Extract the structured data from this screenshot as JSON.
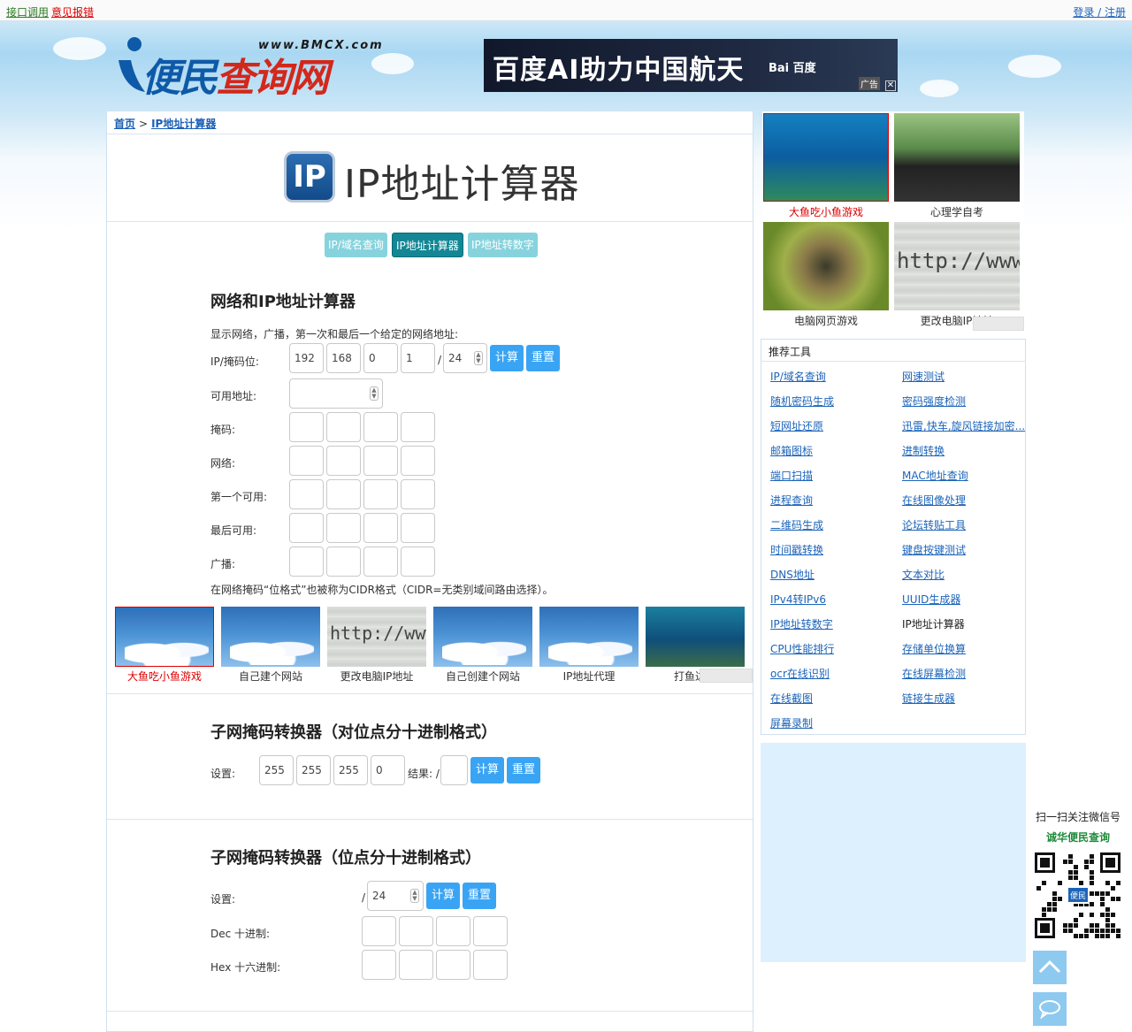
{
  "topbar": {
    "api_link": "接口调用",
    "report_link": "意见报错",
    "login": "登录 / 注册"
  },
  "header": {
    "logo_text_1": "便民",
    "logo_text_2": "查询网",
    "logo_url": "www.BMCX.com",
    "ad": {
      "text": "百度AI助力中国航天",
      "brand": "Bai 百度",
      "ad_tag": "广告",
      "close": "✕"
    }
  },
  "breadcrumb": {
    "home": "首页",
    "sep": ">",
    "current": "IP地址计算器"
  },
  "page": {
    "logo": "IP",
    "title": "IP地址计算器"
  },
  "tabs": [
    {
      "label": "IP/域名查询",
      "active": false
    },
    {
      "label": "IP地址计算器",
      "active": true
    },
    {
      "label": "IP地址转数字",
      "active": false
    }
  ],
  "calc1": {
    "heading": "网络和IP地址计算器",
    "desc": "显示网络，广播，第一次和最后一个给定的网络地址:",
    "ip_label": "IP/掩码位:",
    "ip": [
      "192",
      "168",
      "0",
      "1"
    ],
    "slash": "/",
    "mask": "24",
    "calc_btn": "计算",
    "reset_btn": "重置",
    "usable_label": "可用地址:",
    "mask_label": "掩码:",
    "network_label": "网络:",
    "first_label": "第一个可用:",
    "last_label": "最后可用:",
    "broadcast_label": "广播:",
    "note": "在网络掩码“位格式”也被称为CIDR格式（CIDR=无类别域间路由选择）。"
  },
  "thumbs": [
    {
      "caption": "大鱼吃小鱼游戏",
      "highlight": true
    },
    {
      "caption": "自己建个网站"
    },
    {
      "caption": "更改电脑IP地址"
    },
    {
      "caption": "自己创建个网站"
    },
    {
      "caption": "IP地址代理"
    },
    {
      "caption": "打鱼达人"
    }
  ],
  "calc2": {
    "heading": "子网掩码转换器（对位点分十进制格式）",
    "set_label": "设置:",
    "vals": [
      "255",
      "255",
      "255",
      "0"
    ],
    "result_label": "结果: /",
    "calc_btn": "计算",
    "reset_btn": "重置"
  },
  "calc3": {
    "heading": "子网掩码转换器（位点分十进制格式）",
    "set_label": "设置:",
    "slash": "/",
    "mask": "24",
    "calc_btn": "计算",
    "reset_btn": "重置",
    "dec_label": "Dec 十进制:",
    "hex_label": "Hex 十六进制:"
  },
  "side_grid": [
    {
      "caption": "大鱼吃小鱼游戏",
      "highlight": true
    },
    {
      "caption": "心理学自考"
    },
    {
      "caption": "电脑网页游戏"
    },
    {
      "caption": "更改电脑IP地址"
    }
  ],
  "tools": {
    "heading": "推荐工具",
    "items": [
      "IP/域名查询",
      "网速测试",
      "随机密码生成",
      "密码强度检测",
      "短网址还原",
      "迅雷,快车,旋风链接加密...",
      "邮箱图标",
      "进制转换",
      "端口扫描",
      "MAC地址查询",
      "进程查询",
      "在线图像处理",
      "二维码生成",
      "论坛转贴工具",
      "时间戳转换",
      "键盘按键测试",
      "DNS地址",
      "文本对比",
      "IPv4转IPv6",
      "UUID生成器",
      "IP地址转数字",
      "IP地址计算器",
      "CPU性能排行",
      "存储单位换算",
      "ocr在线识别",
      "在线屏幕检测",
      "在线截图",
      "链接生成器",
      "屏幕录制"
    ],
    "current": "IP地址计算器"
  },
  "float": {
    "scan_text": "扫一扫关注微信号",
    "account": "诚华便民查询",
    "qr_label": "便民"
  },
  "colors": {
    "link": "#1c64b9",
    "button": "#3aa4f4",
    "tab_active": "#138795",
    "tab_inactive": "#86d3dd",
    "highlight": "#d00000"
  }
}
